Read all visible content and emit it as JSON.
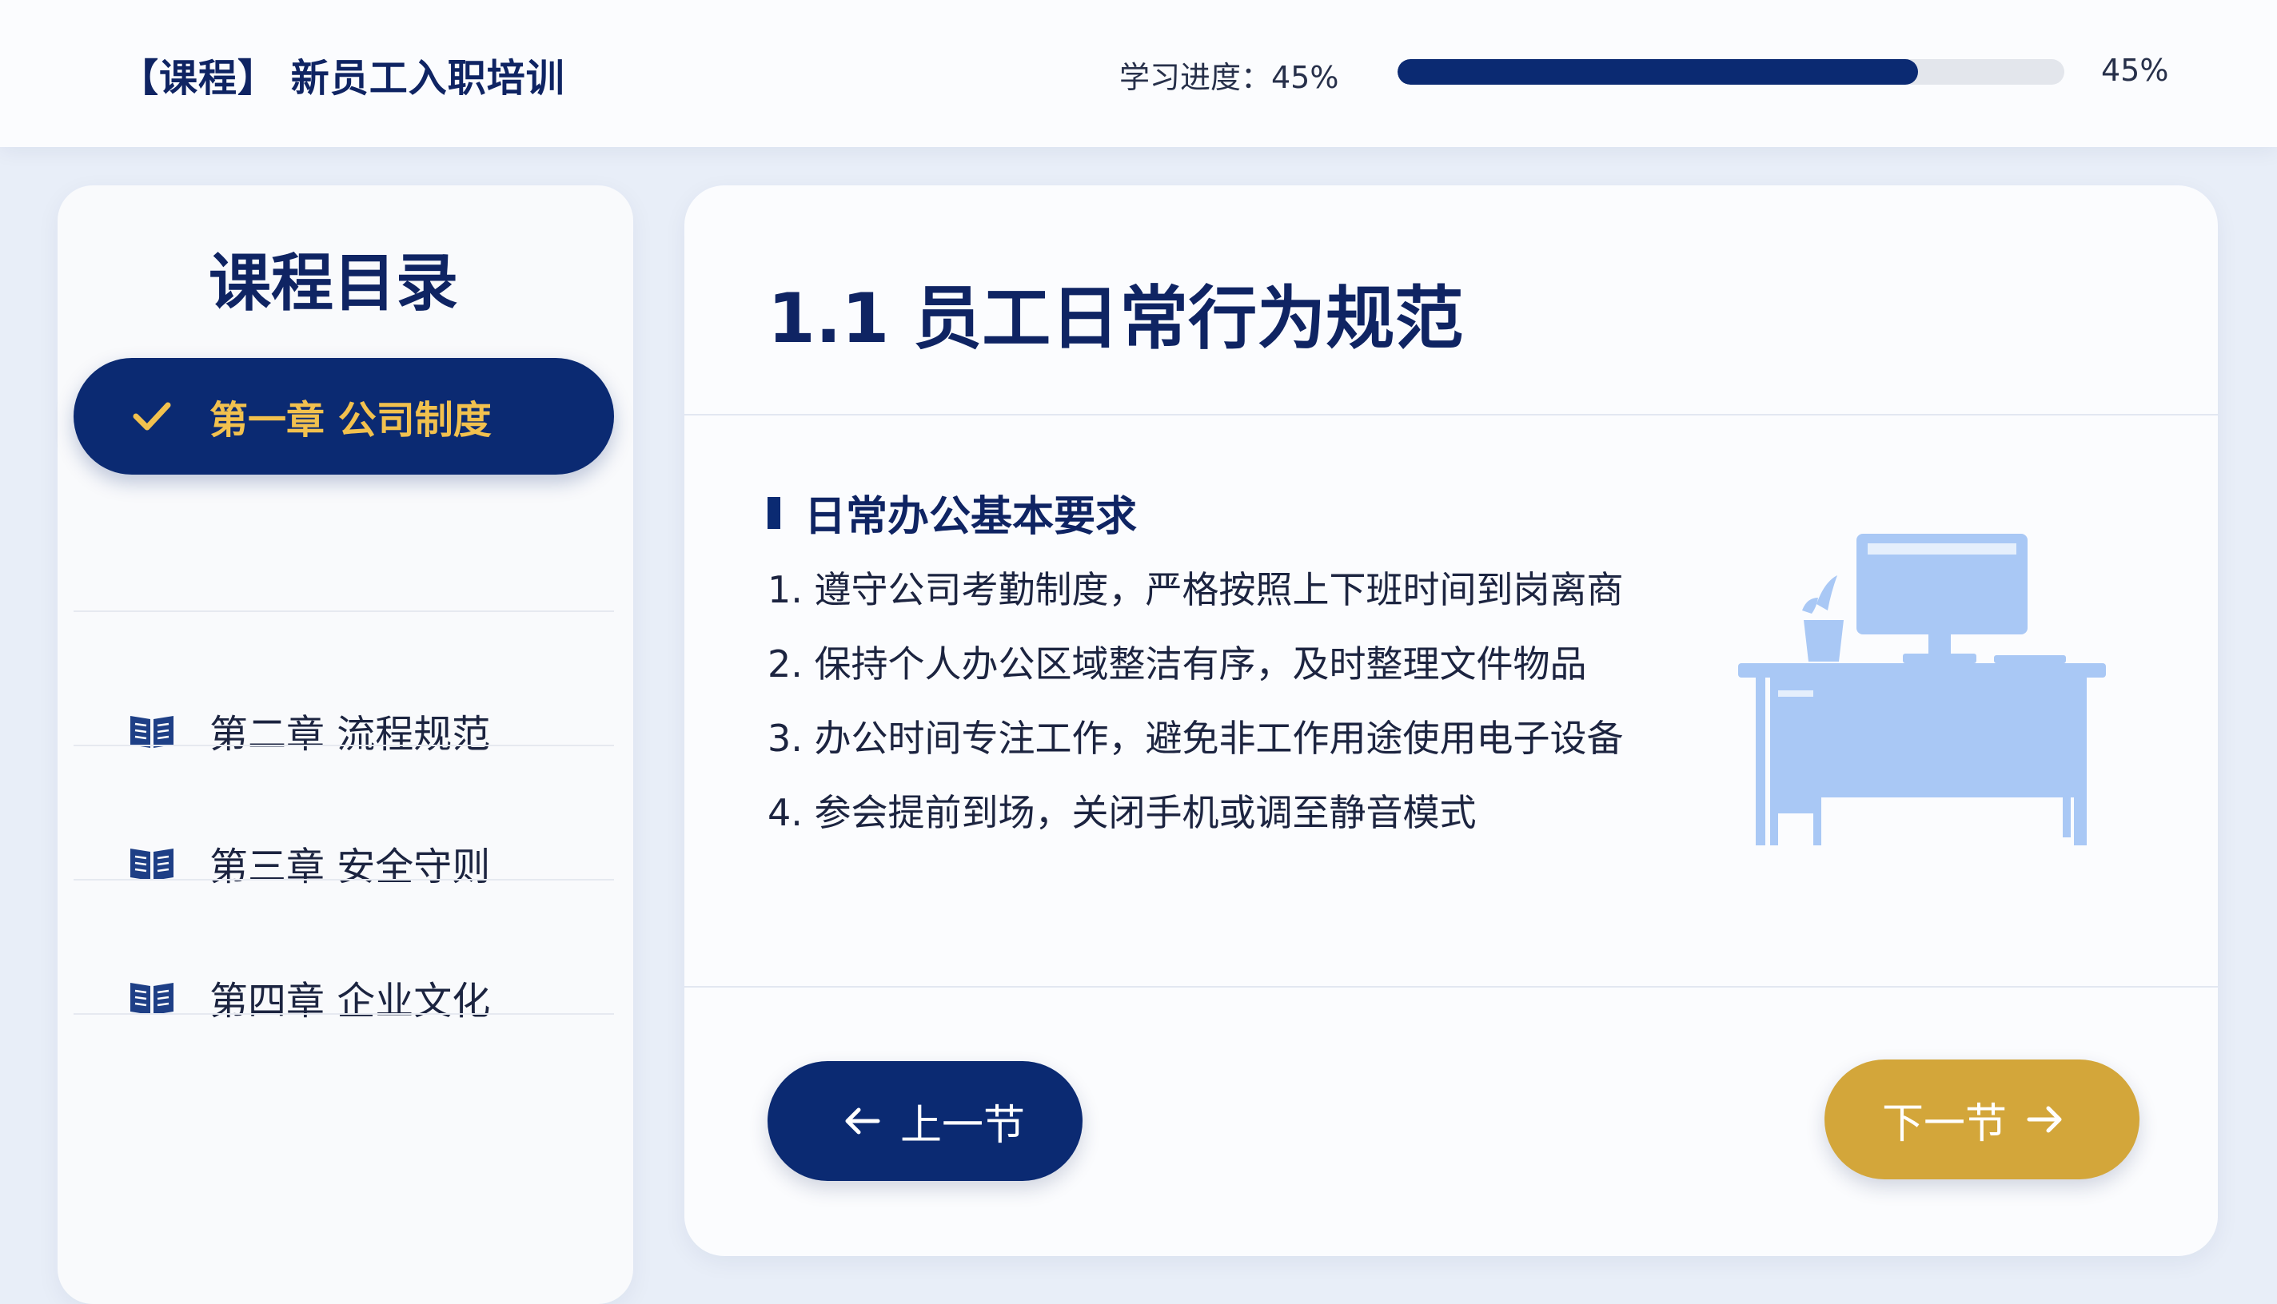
{
  "header": {
    "course_title": "【课程】 新员工入职培训",
    "progress_label": "学习进度：45%",
    "progress_value": 0.78,
    "progress_percent_text": "45%"
  },
  "sidebar": {
    "title": "课程目录",
    "items": [
      {
        "label": "第一章  公司制度",
        "active": true,
        "icon": "check-icon"
      },
      {
        "label": "第二章  流程规范",
        "active": false,
        "icon": "book-icon"
      },
      {
        "label": "第三章  安全守则",
        "active": false,
        "icon": "book-icon"
      },
      {
        "label": "第四章  企业文化",
        "active": false,
        "icon": "book-icon"
      }
    ]
  },
  "main": {
    "section_title": "1.1 员工日常行为规范",
    "sub_heading": "日常办公基本要求",
    "rules": [
      "1. 遵守公司考勤制度，严格按照上下班时间到岗离商",
      "2. 保持个人办公区域整洁有序，及时整理文件物品",
      "3. 办公时间专注工作，避免非工作用途使用电子设备",
      "4. 参会提前到场，关闭手机或调至静音模式"
    ],
    "illustration": "office-desk-illustration"
  },
  "nav": {
    "prev_label": "上一节",
    "next_label": "下一节"
  },
  "colors": {
    "navy": "#0b2a72",
    "gold": "#d3a63a",
    "gold_text": "#f2c14e",
    "illustration_blue": "#a9c8f5"
  }
}
